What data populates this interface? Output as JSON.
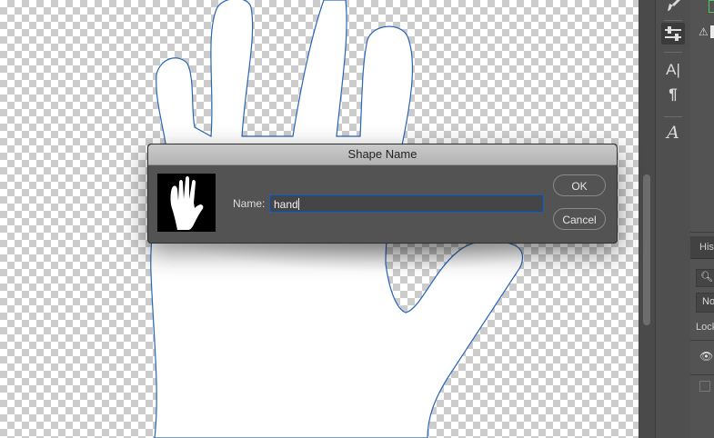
{
  "dialog": {
    "title": "Shape Name",
    "name_label": "Name:",
    "name_value": "hand",
    "ok_label": "OK",
    "cancel_label": "Cancel"
  },
  "panel": {
    "history_tab": "His",
    "filter_label": "No",
    "lock_label": "Lock"
  },
  "tools": [
    {
      "name": "brush-icon"
    },
    {
      "name": "sliders-icon",
      "active": true
    },
    {
      "name": "character-icon",
      "glyph": "A|"
    },
    {
      "name": "paragraph-icon",
      "glyph": "¶"
    },
    {
      "name": "glyphs-icon",
      "glyph": "A"
    }
  ],
  "colors": {
    "path_stroke": "#2a66b8",
    "input_focus": "#2a5b9c",
    "dialog_bg": "#535353"
  }
}
